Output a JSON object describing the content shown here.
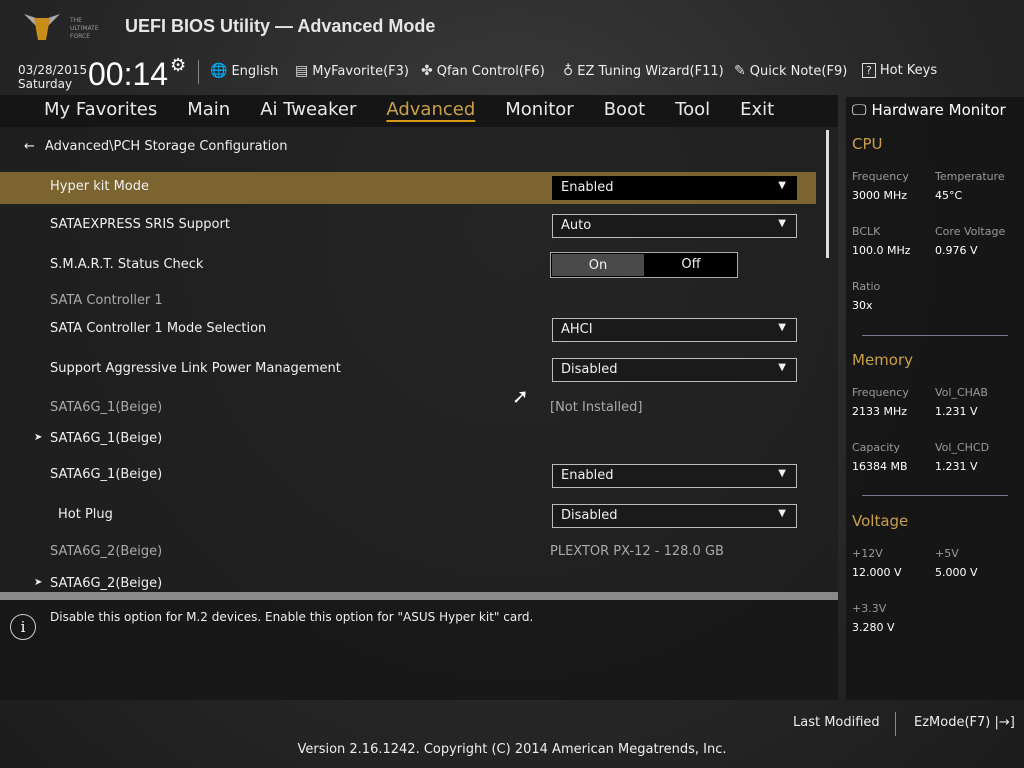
{
  "header": {
    "title": "UEFI BIOS Utility — Advanced Mode",
    "logo_text": "THE ULTIMATE FORCE",
    "date": "03/28/2015",
    "day": "Saturday",
    "time": "00:14"
  },
  "toolbar": [
    {
      "icon": "globe-icon",
      "glyph": "🌐",
      "label": "English"
    },
    {
      "icon": "favorite-list-icon",
      "glyph": "▤",
      "label": "MyFavorite(F3)"
    },
    {
      "icon": "fan-icon",
      "glyph": "✤",
      "label": "Qfan Control(F6)"
    },
    {
      "icon": "lightbulb-icon",
      "glyph": "♁",
      "label": "EZ Tuning Wizard(F11)"
    },
    {
      "icon": "note-icon",
      "glyph": "✎",
      "label": "Quick Note(F9)"
    },
    {
      "icon": "help-icon",
      "glyph": "?",
      "label": "Hot Keys"
    }
  ],
  "nav": {
    "tabs": [
      "My Favorites",
      "Main",
      "Ai Tweaker",
      "Advanced",
      "Monitor",
      "Boot",
      "Tool",
      "Exit"
    ],
    "active": "Advanced"
  },
  "breadcrumb": "Advanced\\PCH Storage Configuration",
  "rows": [
    {
      "label": "Hyper kit Mode",
      "type": "dropdown",
      "value": "Enabled",
      "highlight": true
    },
    {
      "label": "SATAEXPRESS SRIS Support",
      "type": "dropdown",
      "value": "Auto"
    },
    {
      "label": "S.M.A.R.T. Status Check",
      "type": "toggle",
      "on": "On",
      "off": "Off",
      "selected": "On"
    },
    {
      "label": "SATA Controller 1",
      "type": "header"
    },
    {
      "label": "SATA Controller 1 Mode Selection",
      "type": "dropdown",
      "value": "AHCI"
    },
    {
      "label": "Support Aggressive Link Power Management",
      "type": "dropdown",
      "value": "Disabled"
    },
    {
      "label": "SATA6G_1(Beige)",
      "type": "info",
      "value": "[Not Installed]"
    },
    {
      "label": "SATA6G_1(Beige)",
      "type": "submenu"
    },
    {
      "label": "SATA6G_1(Beige)",
      "type": "dropdown",
      "value": "Enabled"
    },
    {
      "label": "Hot Plug",
      "type": "dropdown",
      "value": "Disabled",
      "indent": true
    },
    {
      "label": "SATA6G_2(Beige)",
      "type": "info",
      "value": "PLEXTOR  PX-12 - 128.0 GB"
    },
    {
      "label": "SATA6G_2(Beige)",
      "type": "submenu"
    }
  ],
  "help": "Disable this option for M.2 devices. Enable this option for \"ASUS Hyper kit\" card.",
  "hw": {
    "title": "Hardware Monitor",
    "sections": [
      {
        "name": "CPU",
        "items": [
          {
            "k": "Frequency",
            "v": "3000 MHz"
          },
          {
            "k": "Temperature",
            "v": "45°C"
          },
          {
            "k": "BCLK",
            "v": "100.0 MHz"
          },
          {
            "k": "Core Voltage",
            "v": "0.976 V"
          },
          {
            "k": "Ratio",
            "v": "30x"
          }
        ]
      },
      {
        "name": "Memory",
        "items": [
          {
            "k": "Frequency",
            "v": "2133 MHz"
          },
          {
            "k": "Vol_CHAB",
            "v": "1.231 V"
          },
          {
            "k": "Capacity",
            "v": "16384 MB"
          },
          {
            "k": "Vol_CHCD",
            "v": "1.231 V"
          }
        ]
      },
      {
        "name": "Voltage",
        "items": [
          {
            "k": "+12V",
            "v": "12.000 V"
          },
          {
            "k": "+5V",
            "v": "5.000 V"
          },
          {
            "k": "+3.3V",
            "v": "3.280 V"
          }
        ]
      }
    ]
  },
  "footer": {
    "last_modified": "Last Modified",
    "ezmode": "EzMode(F7)",
    "version": "Version 2.16.1242. Copyright (C) 2014 American Megatrends, Inc."
  },
  "colors": {
    "accent": "#c9a04a",
    "highlight": "#7c6430"
  }
}
